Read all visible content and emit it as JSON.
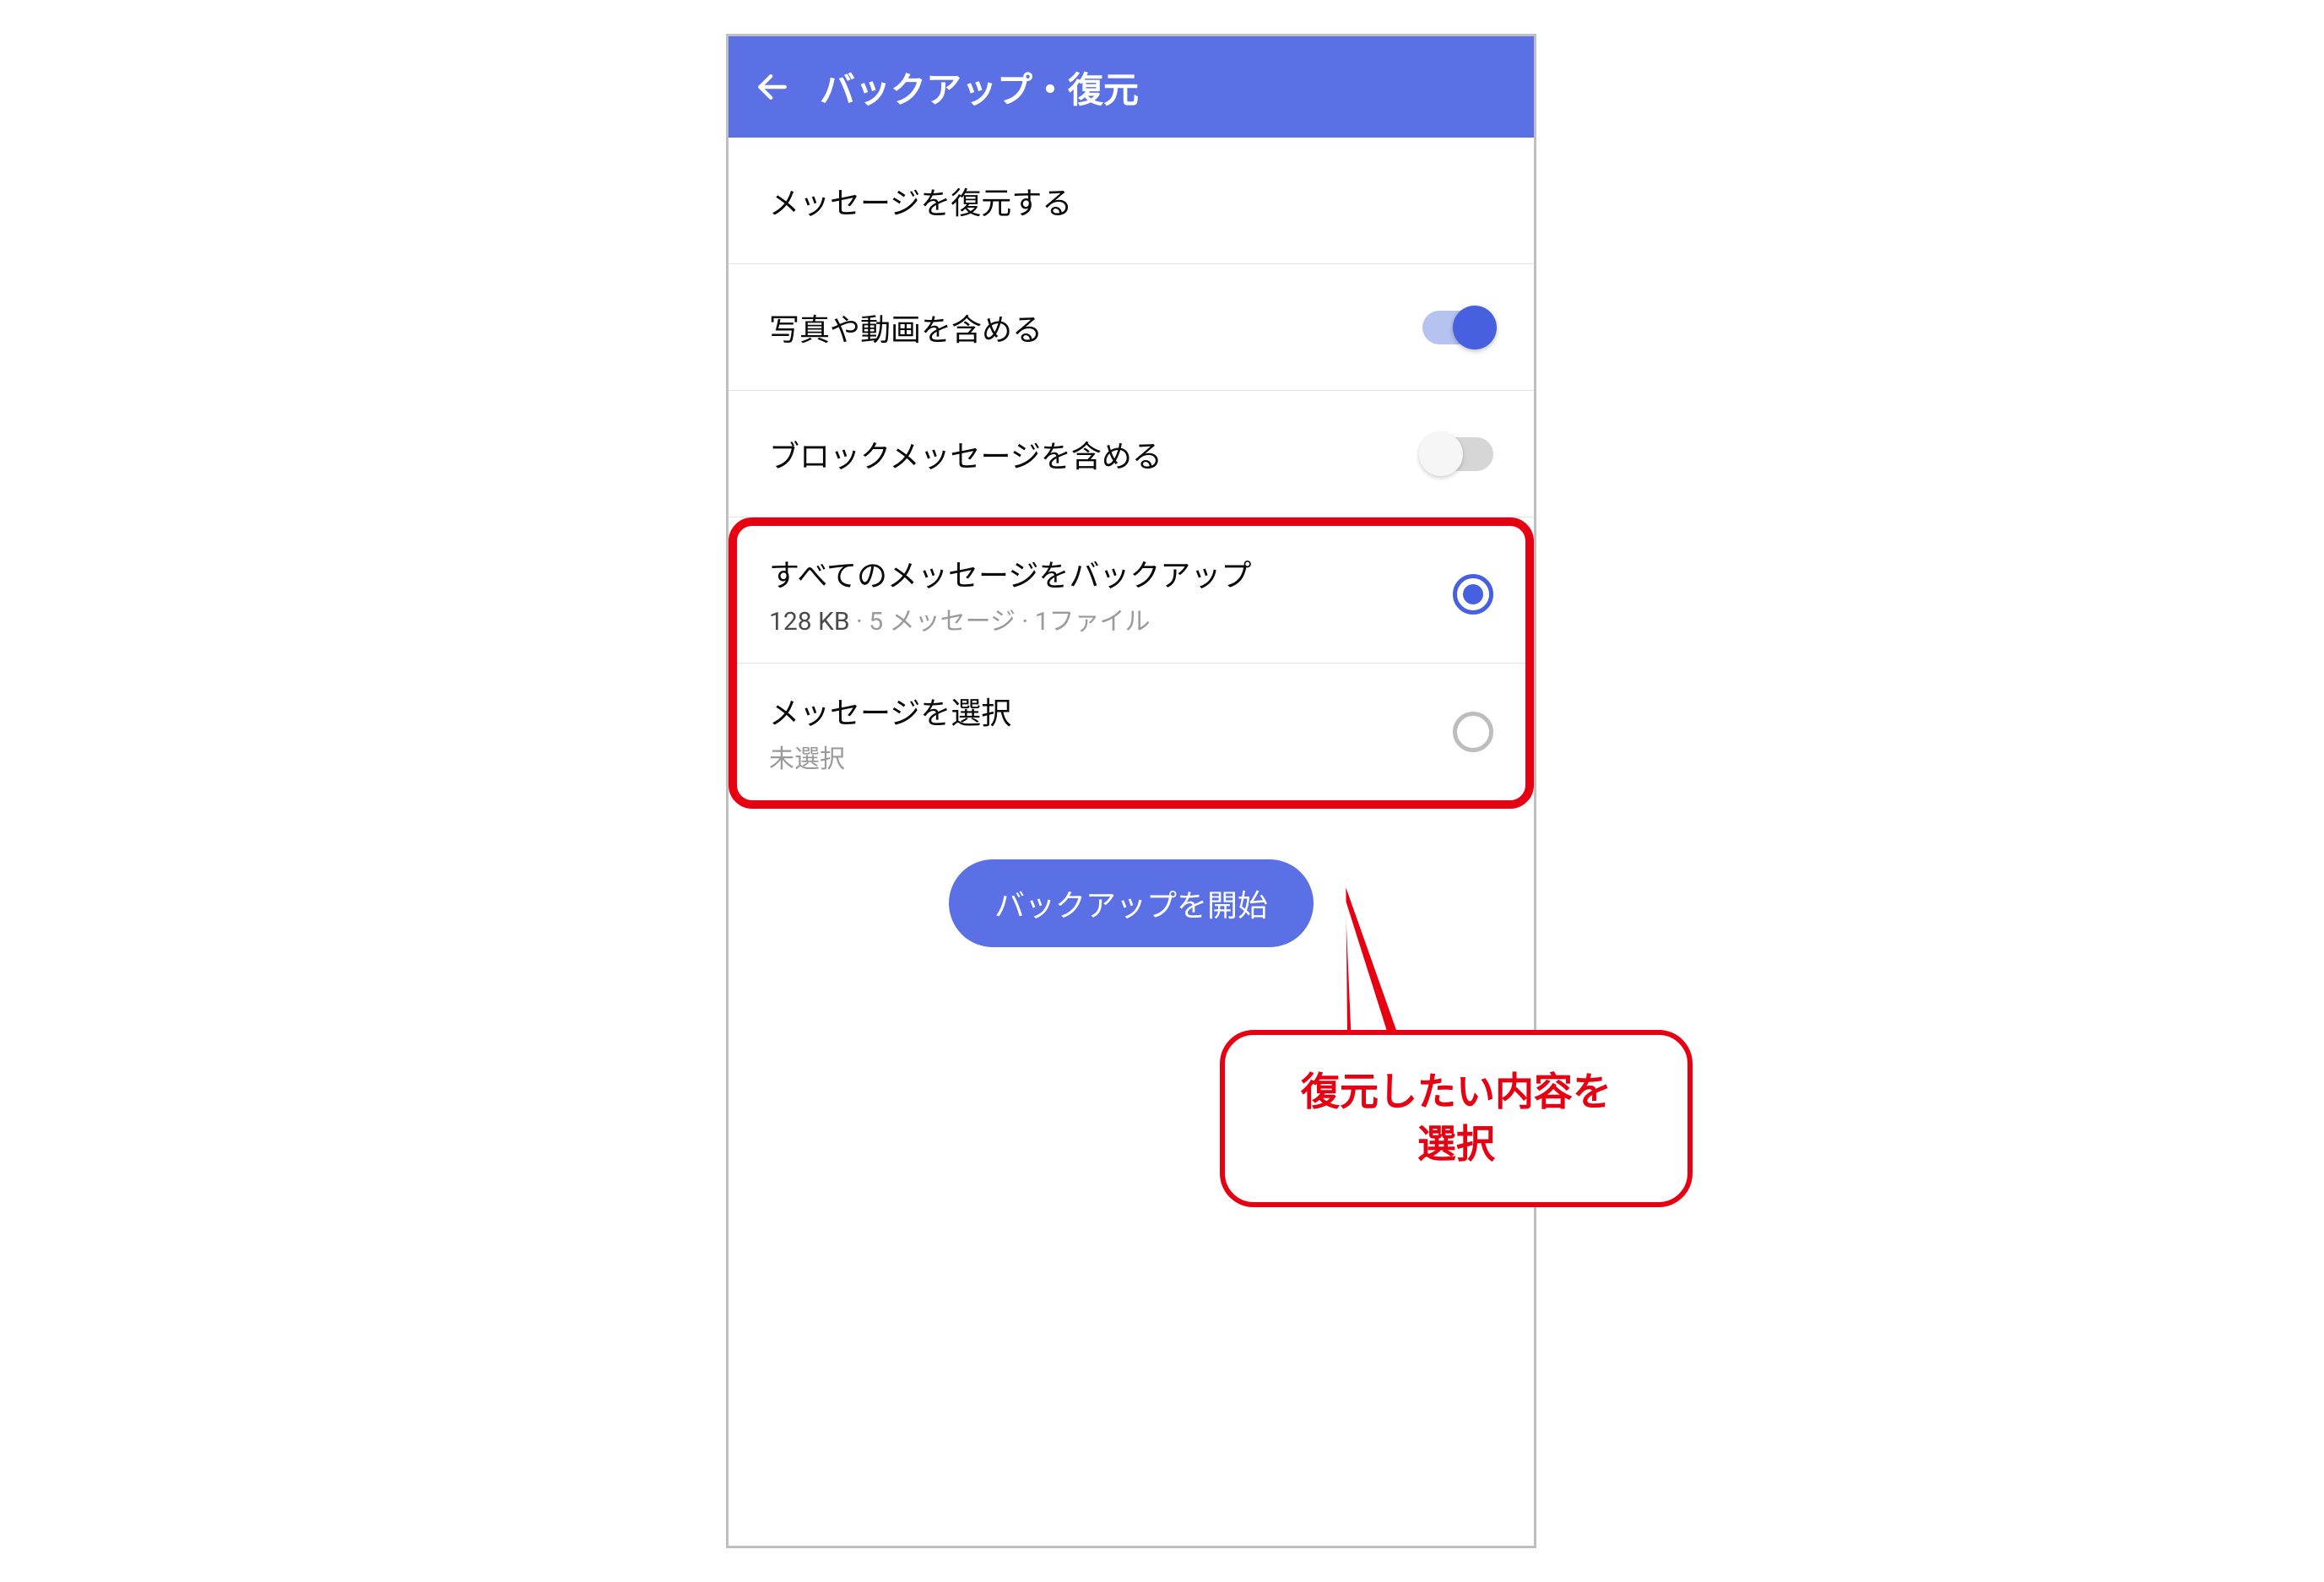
{
  "topbar": {
    "title": "バックアップ・復元"
  },
  "rows": {
    "restore": {
      "label": "メッセージを復元する"
    },
    "include_media": {
      "label": "写真や動画を含める"
    },
    "include_blocked": {
      "label": "ブロックメッセージを含める"
    }
  },
  "radio": {
    "all": {
      "label": "すべてのメッセージをバックアップ",
      "size": "128 KB",
      "detail": " · 5 メッセージ · 1ファイル"
    },
    "select": {
      "label": "メッセージを選択",
      "sub": "未選択"
    }
  },
  "cta": {
    "start_label": "バックアップを開始"
  },
  "callout": {
    "line1": "復元したい内容を",
    "line2": "選択"
  }
}
